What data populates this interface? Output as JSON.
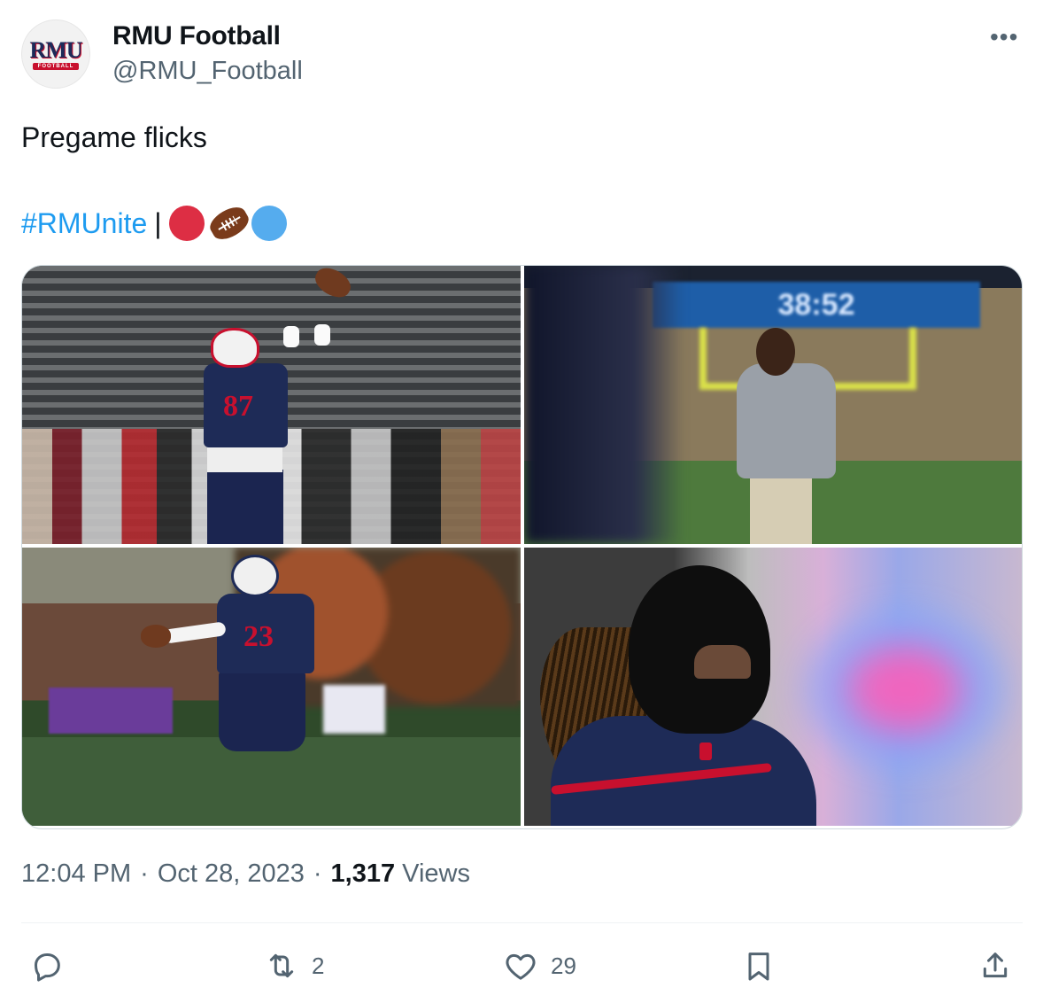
{
  "author": {
    "display_name": "RMU Football",
    "handle": "@RMU_Football",
    "avatar_logo_text": "RMU",
    "avatar_logo_sub": "FOOTBALL",
    "more_label": "•••"
  },
  "tweet": {
    "text": "Pregame flicks",
    "hashtag": "#RMUnite",
    "separator": "|",
    "emojis": [
      "red-circle",
      "american-football",
      "blue-circle"
    ]
  },
  "media": {
    "photos": [
      {
        "name": "receiver-catching-ball",
        "jersey_number": "87"
      },
      {
        "name": "coach-on-sideline",
        "scoreboard_text": "38:52"
      },
      {
        "name": "player-holding-ball",
        "jersey_number": "23"
      },
      {
        "name": "masked-player-portrait"
      }
    ]
  },
  "meta": {
    "time": "12:04 PM",
    "dot1": "·",
    "date": "Oct 28, 2023",
    "dot2": "·",
    "views_count": "1,317",
    "views_label": "Views"
  },
  "actions": {
    "reply": {
      "icon": "reply-icon",
      "count": ""
    },
    "retweet": {
      "icon": "retweet-icon",
      "count": "2"
    },
    "like": {
      "icon": "heart-icon",
      "count": "29"
    },
    "bookmark": {
      "icon": "bookmark-icon",
      "count": ""
    },
    "share": {
      "icon": "share-icon",
      "count": ""
    }
  },
  "colors": {
    "link": "#1d9bf0",
    "secondary_text": "#536471",
    "primary_text": "#0f1419",
    "brand_red": "#c8102e",
    "brand_navy": "#1e2b57"
  }
}
